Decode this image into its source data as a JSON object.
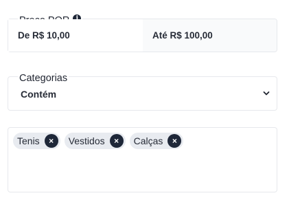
{
  "price": {
    "legend": "Preço POR",
    "info_icon": "i",
    "min_label": "De R$ 10,00",
    "max_label": "Até R$ 100,00"
  },
  "category": {
    "legend": "Categorias",
    "selected": "Contém",
    "chevron_icon": "chevron-down-icon"
  },
  "tags": {
    "items": [
      {
        "label": "Tenis",
        "remove": "×"
      },
      {
        "label": "Vestidos",
        "remove": "×"
      },
      {
        "label": "Calças",
        "remove": "×"
      }
    ]
  },
  "colors": {
    "chip_bg": "#e8ebf0",
    "icon_dark": "#1e2738",
    "border": "#e6e8ec"
  }
}
